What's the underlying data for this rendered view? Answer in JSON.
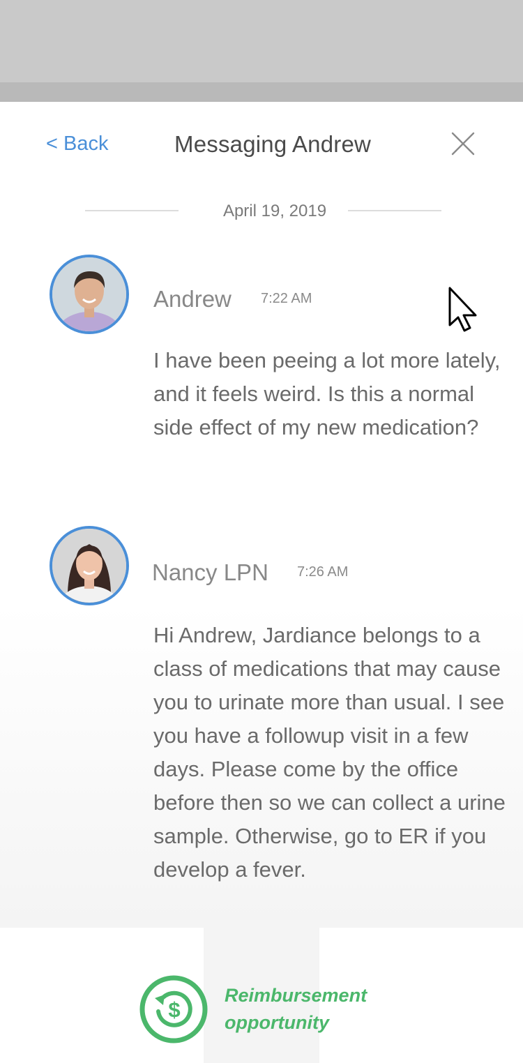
{
  "header": {
    "back_label": "< Back",
    "title": "Messaging Andrew",
    "close_icon": "close-icon"
  },
  "thread": {
    "date": "April 19, 2019",
    "messages": [
      {
        "sender": "Andrew",
        "time": "7:22 AM",
        "text": "I have been peeing a lot more lately, and it feels weird. Is this a normal side effect of my new medication?"
      },
      {
        "sender": "Nancy LPN",
        "time": "7:26 AM",
        "text": "Hi Andrew, Jardiance belongs to a class of medications that may cause you to urinate more than usual. I see you have a followup visit in a few days. Please come by the office before then so we can collect a urine sample. Otherwise, go to ER if you develop a fever."
      }
    ]
  },
  "footer": {
    "reimbursement_label": "Reimbursement opportunity",
    "icon": "dollar-refresh-icon"
  },
  "colors": {
    "accent_blue": "#4a8fd8",
    "accent_green": "#4bb76b",
    "overlay_gray": "#c9c9c9"
  }
}
